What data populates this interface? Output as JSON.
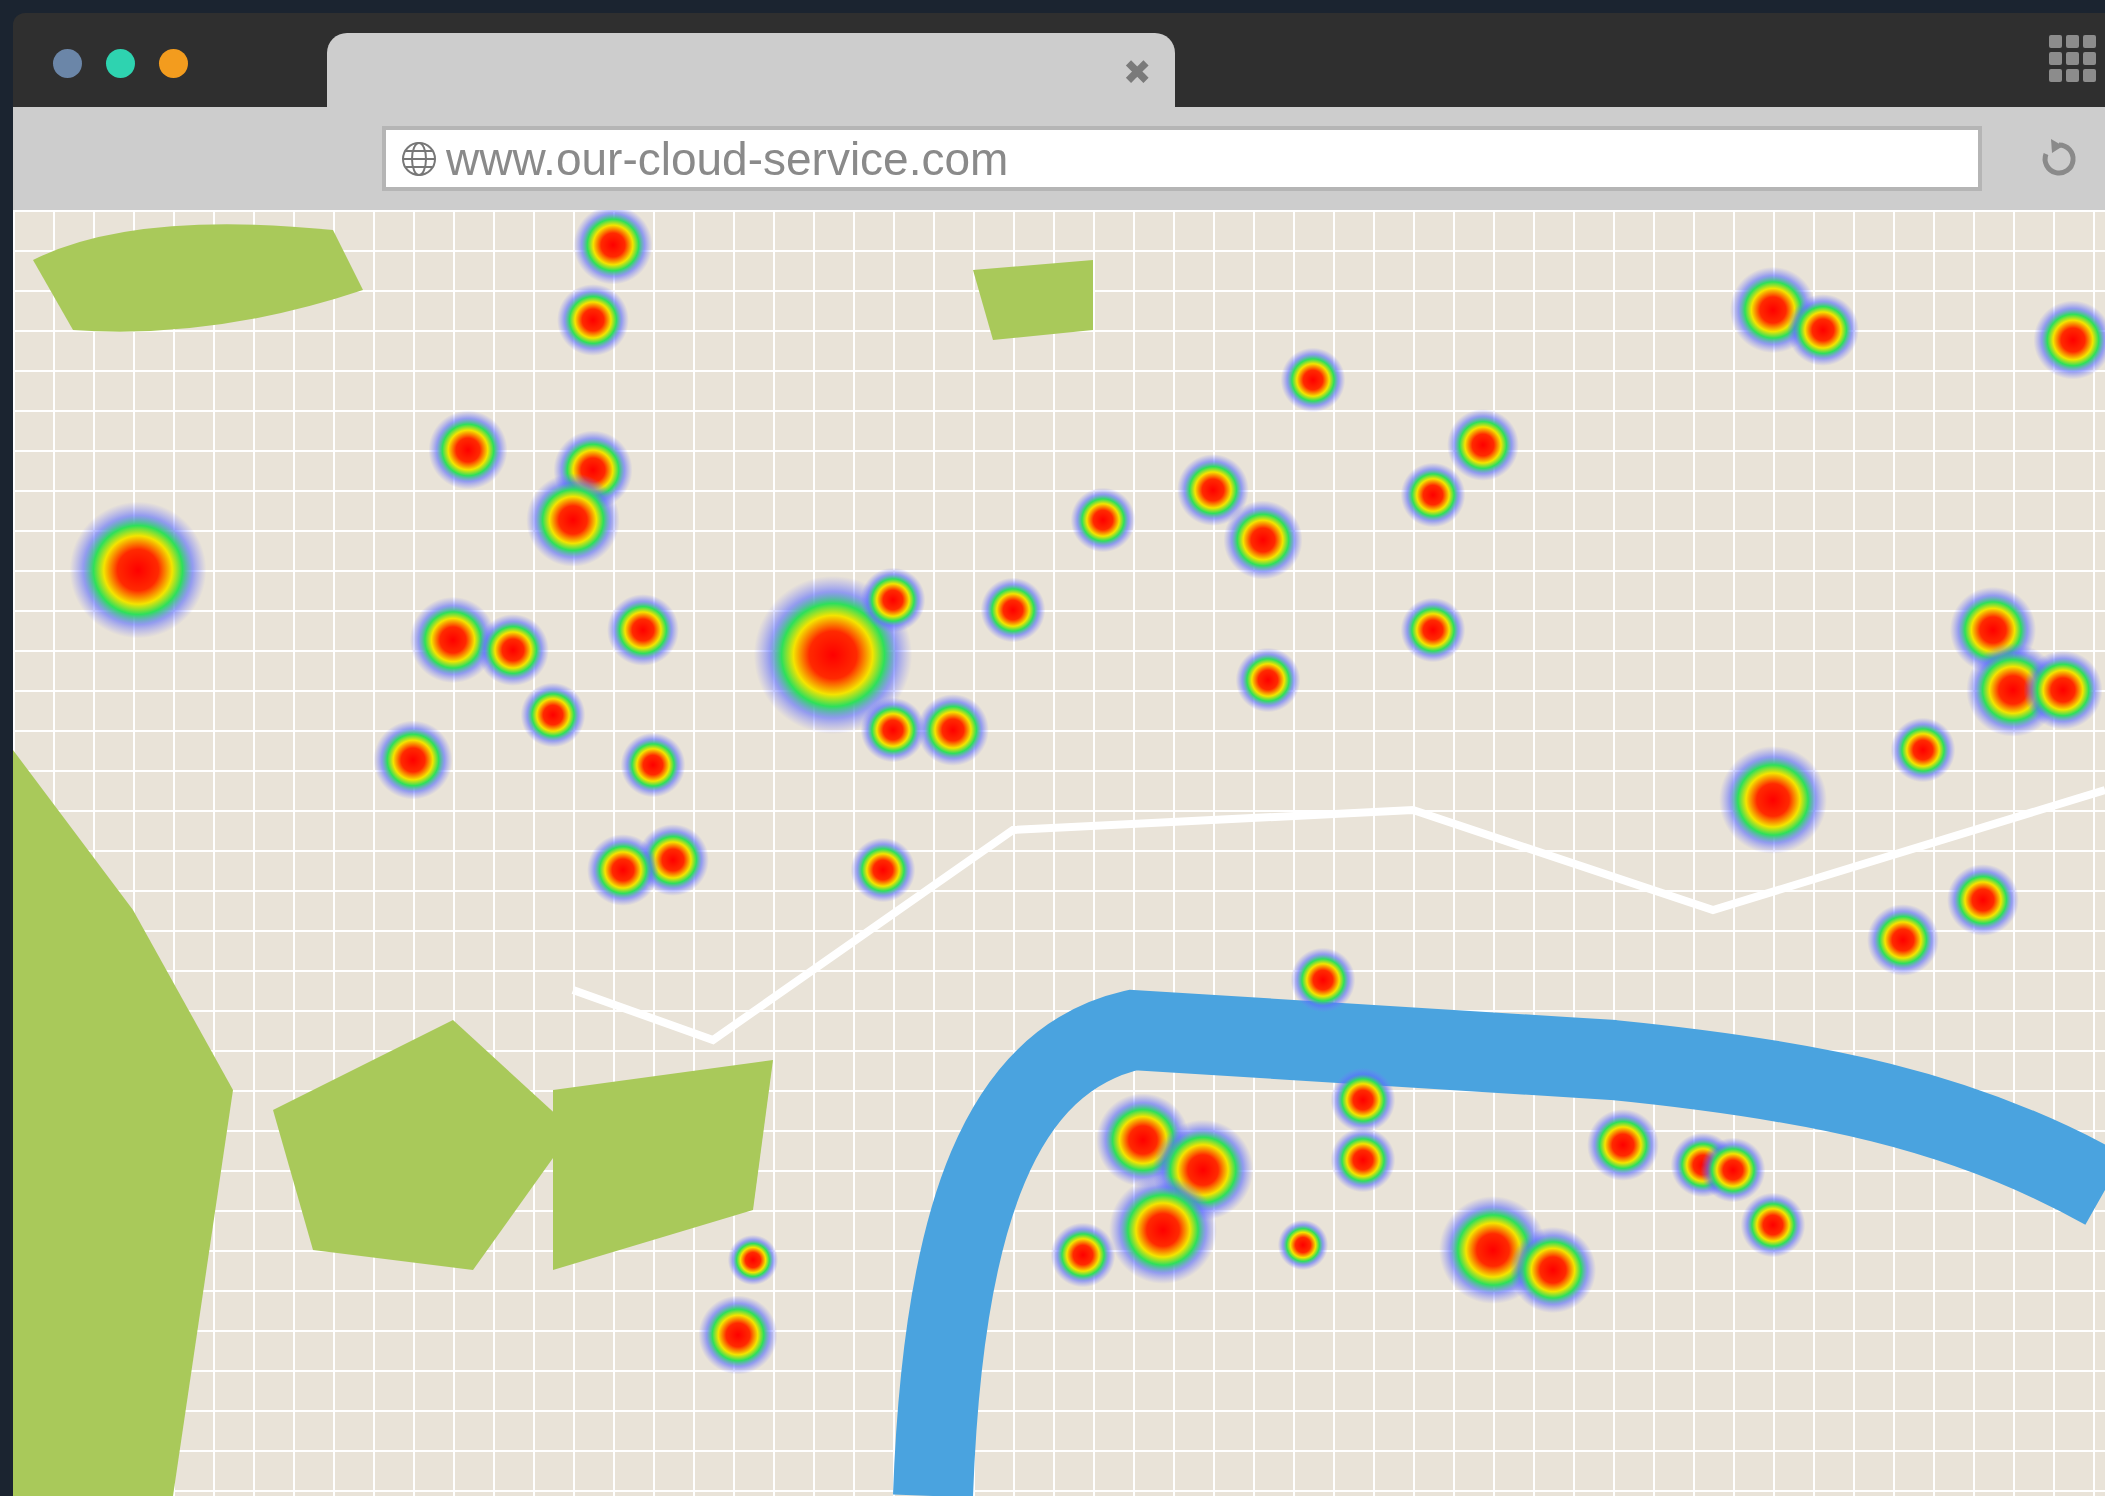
{
  "window": {
    "controls": [
      {
        "color": "#6b86a8"
      },
      {
        "color": "#2ed3b0"
      },
      {
        "color": "#f39c1e"
      }
    ]
  },
  "tab": {
    "close": "✖"
  },
  "address_bar": {
    "url": "www.our-cloud-service.com"
  }
}
